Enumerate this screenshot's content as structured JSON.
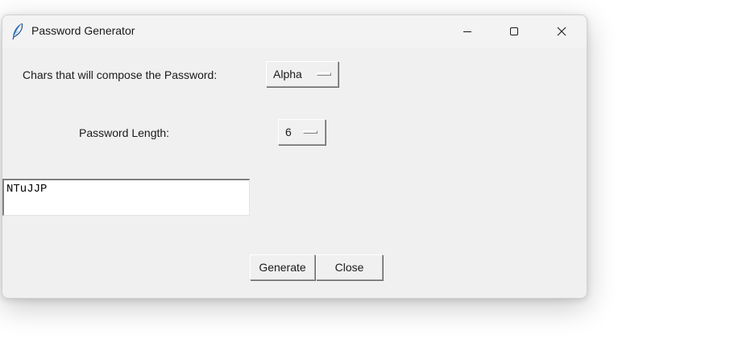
{
  "window": {
    "title": "Password Generator",
    "icon": "feather-icon",
    "controls": {
      "minimize_icon": "minimize-icon",
      "maximize_icon": "maximize-icon",
      "close_icon": "close-icon"
    }
  },
  "form": {
    "chars_label": "Chars that will compose the Password:",
    "chars_value": "Alpha",
    "length_label": "Password Length:",
    "length_value": "6",
    "password_output": "NTuJJP"
  },
  "buttons": {
    "generate_label": "Generate",
    "close_label": "Close"
  },
  "colors": {
    "window_bg": "#f0f0f0",
    "titlebar_bg": "#f3f3f3",
    "entry_bg": "#ffffff",
    "feather_icon": "#2f6fb8"
  }
}
